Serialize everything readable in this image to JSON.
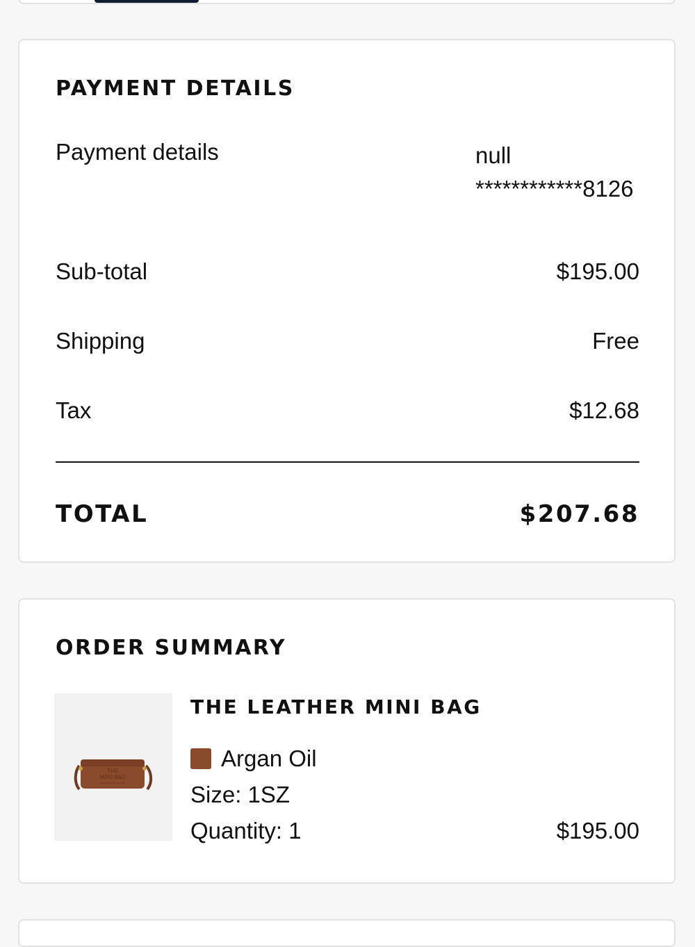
{
  "payment": {
    "title": "PAYMENT DETAILS",
    "method_label": "Payment details",
    "method_name": "null",
    "card_masked": "************8126",
    "subtotal_label": "Sub-total",
    "subtotal_value": "$195.00",
    "shipping_label": "Shipping",
    "shipping_value": "Free",
    "tax_label": "Tax",
    "tax_value": "$12.68",
    "total_label": "TOTAL",
    "total_value": "$207.68"
  },
  "order": {
    "title": "ORDER SUMMARY",
    "item": {
      "name": "THE LEATHER MINI BAG",
      "color": "Argan Oil",
      "color_hex": "#8a4a2c",
      "size": "Size: 1SZ",
      "quantity": "Quantity: 1",
      "price": "$195.00",
      "bag_print": [
        "THE",
        "MINI BAG"
      ]
    }
  }
}
